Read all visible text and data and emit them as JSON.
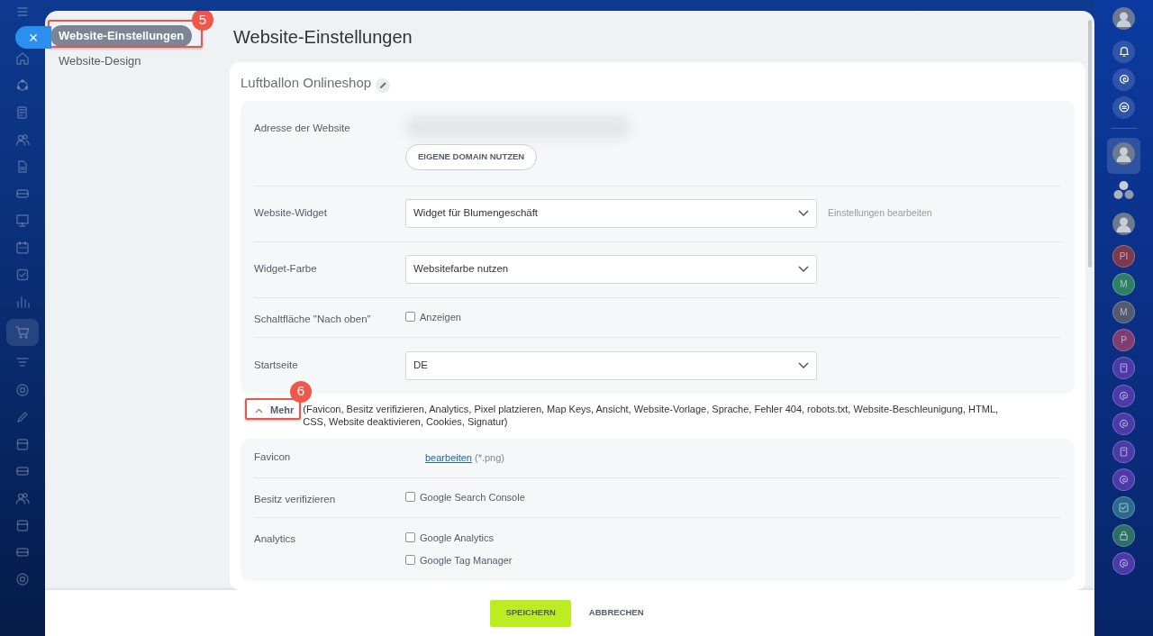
{
  "left_rail": {
    "close": "×",
    "items": [
      {
        "kind": "home",
        "selected": false
      },
      {
        "kind": "cycle",
        "selected": false
      },
      {
        "kind": "document",
        "selected": false
      },
      {
        "kind": "people",
        "selected": false
      },
      {
        "kind": "page",
        "selected": false
      },
      {
        "kind": "card",
        "selected": false
      },
      {
        "kind": "board",
        "selected": false
      },
      {
        "kind": "calendar",
        "selected": false
      },
      {
        "kind": "check",
        "selected": false
      },
      {
        "kind": "chart",
        "selected": false
      },
      {
        "kind": "cart",
        "selected": true
      },
      {
        "kind": "funnel",
        "selected": false
      },
      {
        "kind": "target",
        "selected": false
      },
      {
        "kind": "pencil",
        "selected": false
      },
      {
        "kind": "box",
        "selected": false
      },
      {
        "kind": "card",
        "selected": false
      },
      {
        "kind": "people",
        "selected": false
      },
      {
        "kind": "box",
        "selected": false
      },
      {
        "kind": "card",
        "selected": false
      },
      {
        "kind": "target",
        "selected": false
      }
    ]
  },
  "nav": {
    "callout": "5",
    "items": [
      {
        "label": "Website-Einstellungen",
        "selected": true
      },
      {
        "label": "Website-Design",
        "selected": false
      }
    ]
  },
  "title": "Website-Einstellungen",
  "site_name": "Luftballon Onlineshop",
  "settings": [
    {
      "kind": "address",
      "label": "Adresse der Website",
      "button": "EIGENE DOMAIN NUTZEN"
    },
    {
      "kind": "select",
      "label": "Website-Widget",
      "value": "Widget für Blumengeschäft",
      "link": "Einstellungen bearbeiten"
    },
    {
      "kind": "select",
      "label": "Widget-Farbe",
      "value": "Websitefarbe nutzen"
    },
    {
      "kind": "checkbox",
      "label": "Schaltfläche \"Nach oben\"",
      "options": [
        {
          "label": "Anzeigen",
          "checked": false
        }
      ]
    },
    {
      "kind": "select",
      "label": "Startseite",
      "value": "DE"
    }
  ],
  "more": {
    "label": "Mehr",
    "expanded": true,
    "callout": "6",
    "summary": "(Favicon, Besitz verifizieren, Analytics, Pixel platzieren, Map Keys, Ansicht, Website-Vorlage, Sprache, Fehler 404, robots.txt, Website-Beschleunigung, HTML, CSS, Website deaktivieren, Cookies, Signatur)"
  },
  "more_settings": [
    {
      "kind": "file",
      "label": "Favicon",
      "link": "bearbeiten",
      "note": "(*.png)"
    },
    {
      "kind": "checkbox",
      "label": "Besitz verifizieren",
      "options": [
        {
          "label": "Google Search Console",
          "checked": false
        }
      ]
    },
    {
      "kind": "checkbox",
      "label": "Analytics",
      "options": [
        {
          "label": "Google Analytics",
          "checked": false
        },
        {
          "label": "Google Tag Manager",
          "checked": false
        }
      ]
    }
  ],
  "footer": {
    "buttons": [
      {
        "label": "SPEICHERN",
        "kind": "primary"
      },
      {
        "label": "ABBRECHEN",
        "kind": "link"
      }
    ]
  },
  "right_rail": {
    "items": [
      {
        "kind": "avatar",
        "selected": false
      },
      {
        "kind": "bell",
        "selected": false
      },
      {
        "kind": "spiral",
        "selected": false
      },
      {
        "kind": "chat",
        "selected": false
      },
      {
        "kind": "divider"
      },
      {
        "kind": "avatar",
        "selected": true
      },
      {
        "kind": "group",
        "selected": false
      },
      {
        "kind": "avatar",
        "selected": false
      },
      {
        "kind": "initials",
        "text": "PI",
        "color": "#7d3a4e",
        "selected": false
      },
      {
        "kind": "initials",
        "text": "M",
        "color": "#2f7f66",
        "selected": false
      },
      {
        "kind": "initials",
        "text": "M",
        "color": "#545a70",
        "selected": false
      },
      {
        "kind": "initials",
        "text": "P",
        "color": "#7f3d73",
        "selected": false
      },
      {
        "kind": "book",
        "color": "#4b3aa8",
        "selected": false
      },
      {
        "kind": "spiral",
        "color": "#4b3aa8",
        "selected": false
      },
      {
        "kind": "spiral",
        "color": "#4b3aa8",
        "selected": false
      },
      {
        "kind": "book",
        "color": "#4b3aa8",
        "selected": false
      },
      {
        "kind": "spiral",
        "color": "#4b3aa8",
        "selected": false
      },
      {
        "kind": "check",
        "color": "#2a6a8c",
        "selected": false
      },
      {
        "kind": "lock",
        "color": "#2c6f66",
        "selected": false
      },
      {
        "kind": "spiral",
        "color": "#4b3aa8",
        "selected": false
      }
    ]
  }
}
